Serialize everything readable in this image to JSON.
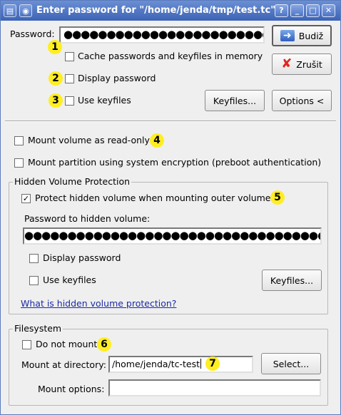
{
  "window": {
    "title": "Enter password for \"/home/jenda/tmp/test.tc\"",
    "buttons": {
      "help": "?",
      "minimize": "_",
      "maximize": "□",
      "close": "✕"
    }
  },
  "password": {
    "label": "Password:",
    "masked_value": "●●●●●●●●●●●●●●●●●●●●●●●●●●●●●"
  },
  "options": {
    "cache": "Cache passwords and keyfiles in memory",
    "display_password": "Display password",
    "use_keyfiles": "Use keyfiles"
  },
  "buttons": {
    "ok": "Budiž",
    "cancel": "Zrušit",
    "keyfiles": "Keyfiles...",
    "options": "Options <"
  },
  "mount": {
    "read_only": "Mount volume as read-only",
    "system_encryption": "Mount partition using system encryption (preboot authentication)"
  },
  "hidden": {
    "legend": "Hidden Volume Protection",
    "protect": "Protect hidden volume when mounting outer volume",
    "protect_checked": "✓",
    "password_label": "Password to hidden volume:",
    "masked_value": "●●●●●●●●●●●●●●●●●●●●●●●●●●●●●●●●●●●●",
    "display_password": "Display password",
    "use_keyfiles": "Use keyfiles",
    "keyfiles_button": "Keyfiles...",
    "help_link": "What is hidden volume protection?"
  },
  "filesystem": {
    "legend": "Filesystem",
    "do_not_mount": "Do not mount",
    "mount_dir_label": "Mount at directory:",
    "mount_dir_value": "/home/jenda/tc-test",
    "select_button": "Select...",
    "mount_options_label": "Mount options:",
    "mount_options_value": ""
  },
  "callouts": [
    "1",
    "2",
    "3",
    "4",
    "5",
    "6",
    "7"
  ],
  "icons": {
    "app": "lock-icon",
    "ok": "ok-arrow-icon",
    "cancel": "red-x-icon"
  },
  "colors": {
    "titlebar": "#3c63b5",
    "callout": "#ffee22",
    "link": "#1b2aa5"
  }
}
